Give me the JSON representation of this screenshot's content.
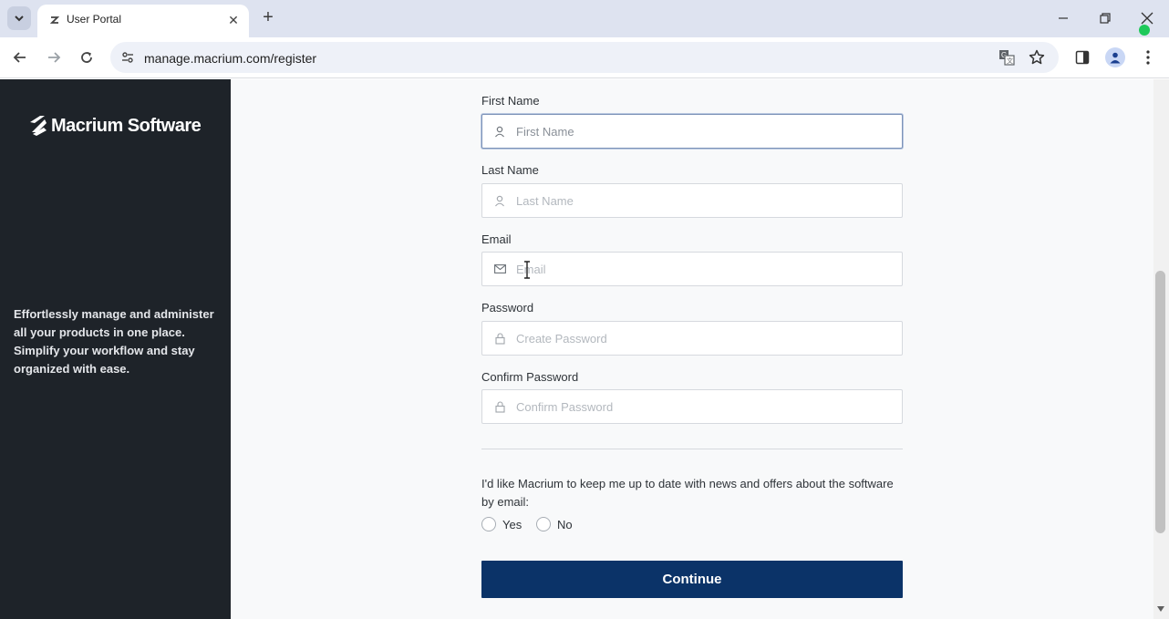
{
  "browser": {
    "tab_title": "User Portal",
    "tab_close": "✕",
    "new_tab": "+",
    "url": "manage.macrium.com/register"
  },
  "sidebar": {
    "brand": "Macrium Software",
    "tagline": "Effortlessly manage and administer all your products in one place. Simplify your workflow and stay organized with ease."
  },
  "form": {
    "first_name": {
      "label": "First Name",
      "placeholder": "First Name",
      "value": ""
    },
    "last_name": {
      "label": "Last Name",
      "placeholder": "Last Name",
      "value": ""
    },
    "email": {
      "label": "Email",
      "placeholder": "Email",
      "value": ""
    },
    "password": {
      "label": "Password",
      "placeholder": "Create Password",
      "value": ""
    },
    "confirm_password": {
      "label": "Confirm Password",
      "placeholder": "Confirm Password",
      "value": ""
    },
    "consent_text": "I'd like Macrium to keep me up to date with news and offers about the software by email:",
    "option_yes": "Yes",
    "option_no": "No",
    "continue_label": "Continue"
  },
  "icons": {
    "first_name": "user-icon",
    "last_name": "user-icon",
    "email": "mail-icon",
    "password": "lock-icon",
    "confirm_password": "lock-icon"
  },
  "colors": {
    "sidebar_bg": "#1e2329",
    "primary_button": "#0b3368",
    "page_bg": "#f8f9fa",
    "status_dot": "#1ec95a"
  }
}
